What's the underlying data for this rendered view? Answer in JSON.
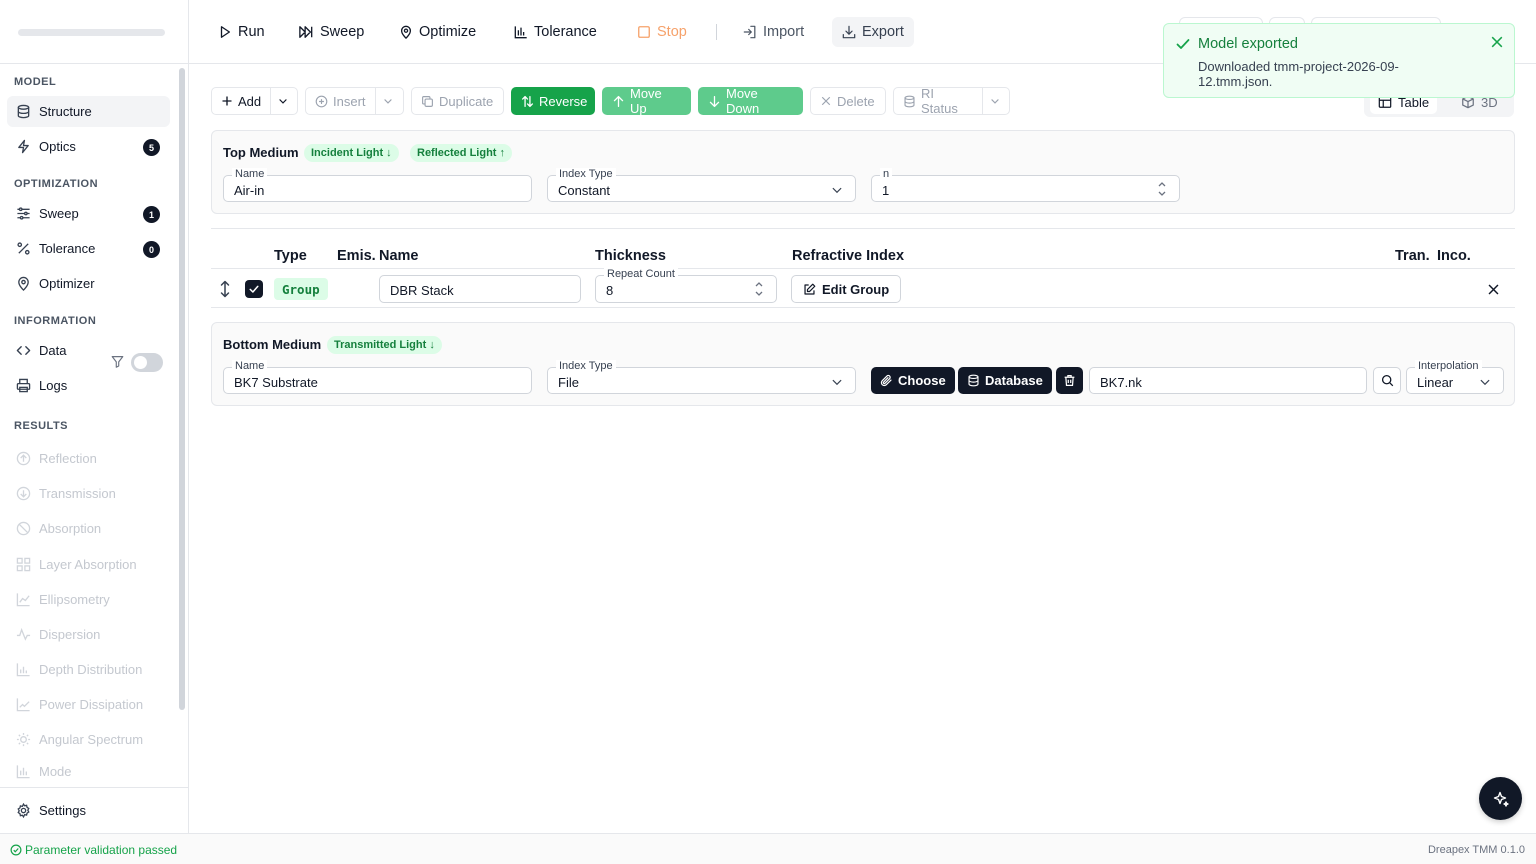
{
  "toolbar": {
    "run": "Run",
    "sweep": "Sweep",
    "optimize": "Optimize",
    "tolerance": "Tolerance",
    "stop": "Stop",
    "import": "Import",
    "export": "Export"
  },
  "sidebar": {
    "model_label": "MODEL",
    "structure": "Structure",
    "optics": "Optics",
    "optics_count": "5",
    "optimization_label": "OPTIMIZATION",
    "sweep": "Sweep",
    "sweep_count": "1",
    "tolerance": "Tolerance",
    "tolerance_count": "0",
    "optimizer": "Optimizer",
    "information_label": "INFORMATION",
    "data": "Data",
    "logs": "Logs",
    "results_label": "RESULTS",
    "results": [
      "Reflection",
      "Transmission",
      "Absorption",
      "Layer Absorption",
      "Ellipsometry",
      "Dispersion",
      "Depth Distribution",
      "Power Dissipation",
      "Angular Spectrum",
      "Mode"
    ],
    "settings": "Settings"
  },
  "actions": {
    "add": "Add",
    "insert": "Insert",
    "duplicate": "Duplicate",
    "reverse": "Reverse",
    "move_up": "Move Up",
    "move_down": "Move Down",
    "delete": "Delete",
    "ri_status": "RI Status",
    "view_table": "Table",
    "view_3d": "3D"
  },
  "top_medium": {
    "title": "Top Medium",
    "chip_incident": "Incident Light ↓",
    "chip_reflected": "Reflected Light ↑",
    "name_label": "Name",
    "name_value": "Air-in",
    "index_type_label": "Index Type",
    "index_type_value": "Constant",
    "n_label": "n",
    "n_value": "1"
  },
  "layer_table": {
    "headers": {
      "type": "Type",
      "emis": "Emis.",
      "name": "Name",
      "thickness": "Thickness",
      "refractive_index": "Refractive Index",
      "tran": "Tran.",
      "inco": "Inco."
    },
    "rows": [
      {
        "type": "Group",
        "checked": true,
        "name": "DBR Stack",
        "thickness_label": "Repeat Count",
        "thickness_value": "8",
        "ri_button": "Edit Group"
      }
    ]
  },
  "bottom_medium": {
    "title": "Bottom Medium",
    "chip_transmitted": "Transmitted Light ↓",
    "name_label": "Name",
    "name_value": "BK7 Substrate",
    "index_type_label": "Index Type",
    "index_type_value": "File",
    "choose": "Choose",
    "database": "Database",
    "file_value": "BK7.nk",
    "interpolation_label": "Interpolation",
    "interpolation_value": "Linear"
  },
  "toast": {
    "title": "Model exported",
    "message": "Downloaded tmm-project-2026-09-12.tmm.json."
  },
  "status": {
    "validation": "Parameter validation passed",
    "version": "Dreapex TMM 0.1.0"
  },
  "colors": {
    "accent_green": "#16a34a",
    "stop_orange": "#f6a26b",
    "dark": "#111827"
  }
}
